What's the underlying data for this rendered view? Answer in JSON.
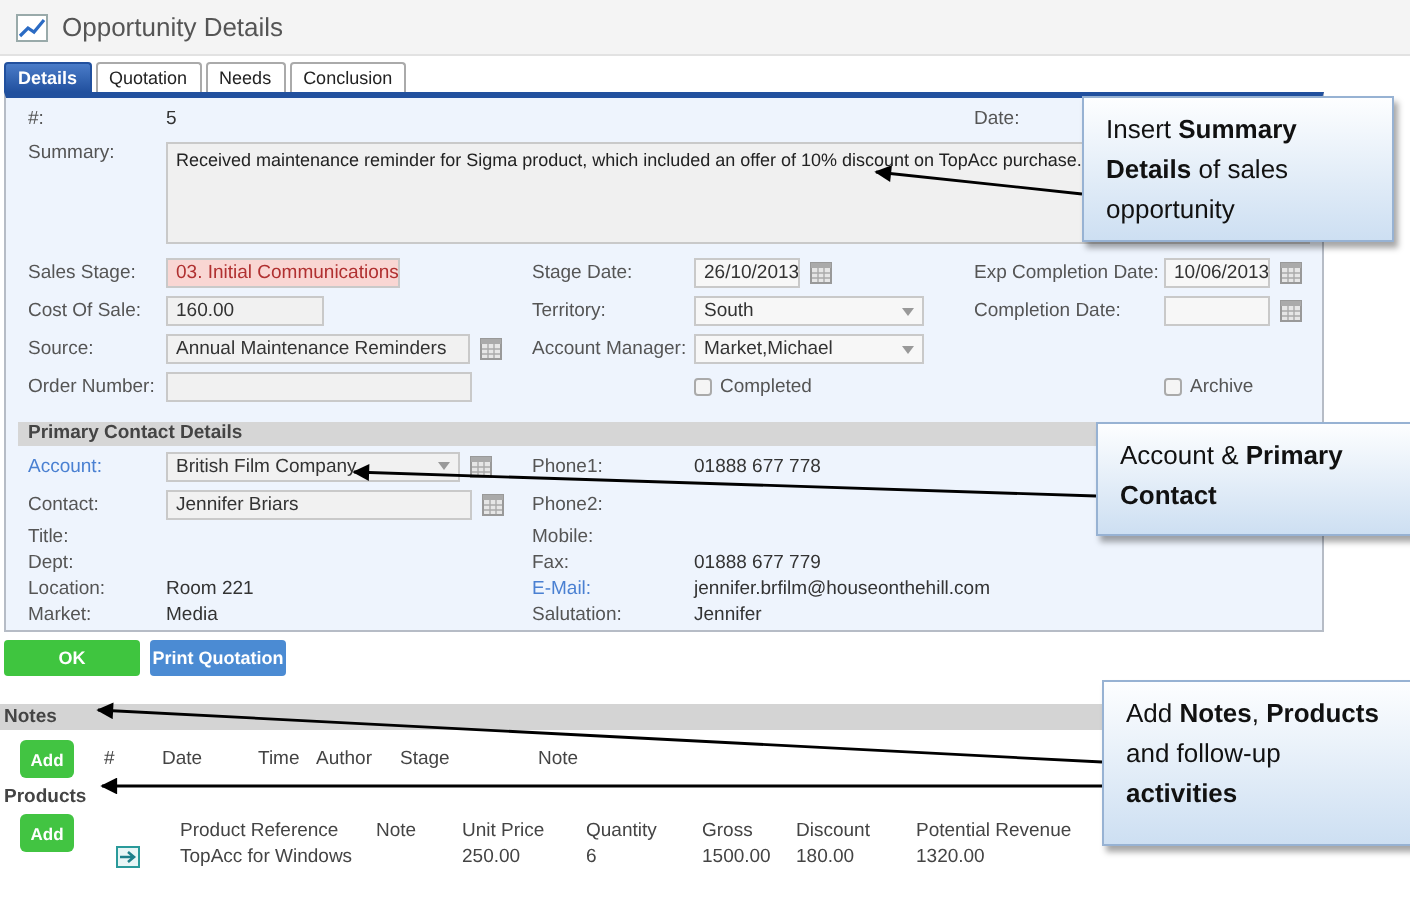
{
  "window": {
    "title": "Opportunity Details"
  },
  "tabs": [
    {
      "label": "Details",
      "selected": true
    },
    {
      "label": "Quotation",
      "selected": false
    },
    {
      "label": "Needs",
      "selected": false
    },
    {
      "label": "Conclusion",
      "selected": false
    }
  ],
  "details": {
    "summary": {
      "label": "Summary:",
      "value": "Received maintenance reminder for Sigma product, which included an offer of 10% discount on TopAcc purchase."
    },
    "rows": [
      {
        "left": {
          "label": "#:",
          "kind": "text",
          "value": "5"
        },
        "right": {
          "label": "Date:",
          "kind": "text"
        }
      },
      {
        "left": {
          "label": "Sales Stage:",
          "kind": "select",
          "value": "03. Initial Communications",
          "flagged": true
        },
        "center": {
          "label": "Stage Date:",
          "kind": "date",
          "value": "26/10/2013"
        },
        "right": {
          "label": "Exp Completion Date:",
          "kind": "date",
          "value": "10/06/2013"
        }
      },
      {
        "left": {
          "label": "Cost Of Sale:",
          "kind": "input",
          "value": "160.00"
        },
        "center": {
          "label": "Territory:",
          "kind": "select",
          "value": "South"
        },
        "right": {
          "label": "Completion Date:",
          "kind": "date"
        }
      },
      {
        "left": {
          "label": "Source:",
          "kind": "lookup",
          "value": "Annual Maintenance Reminders"
        },
        "center": {
          "label": "Account Manager:",
          "kind": "select",
          "value": "Market,Michael"
        }
      },
      {
        "left": {
          "label": "Order Number:",
          "kind": "input"
        },
        "center": {
          "kind": "checkbox",
          "text": "Completed",
          "checked": false
        },
        "right": {
          "kind": "checkbox",
          "text": "Archive",
          "checked": false
        }
      }
    ]
  },
  "contact": {
    "title": "Primary Contact Details",
    "rows": [
      {
        "left": {
          "label": "Account:",
          "link": true,
          "kind": "select-lookup",
          "value": "British Film Company"
        },
        "center": {
          "label": "Phone1:",
          "kind": "text",
          "value": "01888 677 778"
        }
      },
      {
        "left": {
          "label": "Contact:",
          "kind": "lookup",
          "value": "Jennifer Briars"
        },
        "center": {
          "label": "Phone2:",
          "kind": "text"
        }
      },
      {
        "left": {
          "label": "Title:",
          "kind": "text"
        },
        "center": {
          "label": "Mobile:",
          "kind": "text"
        }
      },
      {
        "left": {
          "label": "Dept:",
          "kind": "text"
        },
        "center": {
          "label": "Fax:",
          "kind": "text",
          "value": "01888 677 779"
        }
      },
      {
        "left": {
          "label": "Location:",
          "kind": "text",
          "value": "Room 221"
        },
        "center": {
          "label": "E-Mail:",
          "link": true,
          "kind": "text",
          "value": "jennifer.brfilm@houseonthehill.com"
        }
      },
      {
        "left": {
          "label": "Market:",
          "kind": "text",
          "value": "Media"
        },
        "center": {
          "label": "Salutation:",
          "kind": "text",
          "value": "Jennifer"
        }
      }
    ]
  },
  "buttons": [
    {
      "label": "OK",
      "kind": "confirm"
    },
    {
      "label": "Print Quotation",
      "kind": "action"
    }
  ],
  "notes": {
    "title": "Notes",
    "add": "Add",
    "columns": [
      "#",
      "Date",
      "Time",
      "Author",
      "Stage",
      "Note"
    ]
  },
  "products": {
    "title": "Products",
    "add": "Add",
    "columns": [
      "Product Reference",
      "Note",
      "Unit Price",
      "Quantity",
      "Gross",
      "Discount",
      "Potential Revenue"
    ],
    "rows": [
      {
        "product_reference": "TopAcc for Windows",
        "unit_price": "250.00",
        "quantity": "6",
        "gross": "1500.00",
        "discount": "180.00",
        "potential_revenue": "1320.00"
      }
    ]
  },
  "callouts": [
    {
      "text": "Insert **Summary Details** of sales opportunity"
    },
    {
      "text": "Account & **Primary Contact**"
    },
    {
      "text": "Add **Notes**, **Products** and follow-up **activities**"
    }
  ]
}
